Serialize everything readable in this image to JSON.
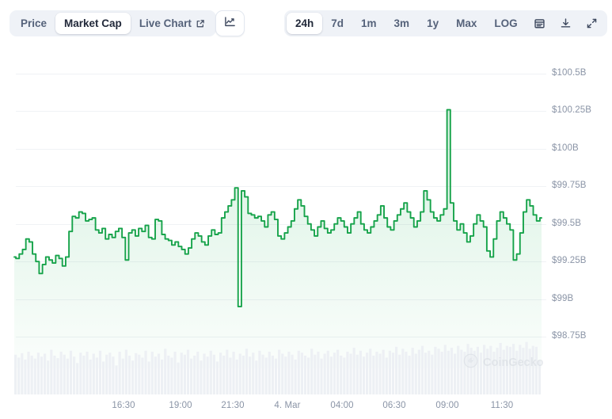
{
  "toolbar": {
    "metric_tabs": [
      {
        "label": "Price",
        "name": "tab-price",
        "active": false,
        "icon": ""
      },
      {
        "label": "Market Cap",
        "name": "tab-market-cap",
        "active": true,
        "icon": ""
      },
      {
        "label": "Live Chart",
        "name": "tab-live-chart",
        "active": false,
        "icon": "external-link-icon"
      }
    ],
    "chart_type_button": {
      "label": "",
      "icon": "line-chart-icon"
    },
    "range_tabs": [
      {
        "label": "24h",
        "name": "range-24h",
        "active": true
      },
      {
        "label": "7d",
        "name": "range-7d",
        "active": false
      },
      {
        "label": "1m",
        "name": "range-1m",
        "active": false
      },
      {
        "label": "3m",
        "name": "range-3m",
        "active": false
      },
      {
        "label": "1y",
        "name": "range-1y",
        "active": false
      },
      {
        "label": "Max",
        "name": "range-max",
        "active": false
      },
      {
        "label": "LOG",
        "name": "scale-log",
        "active": false
      }
    ],
    "action_icons": [
      {
        "name": "calendar-icon",
        "label": "calendar-icon"
      },
      {
        "name": "download-icon",
        "label": "download-icon"
      },
      {
        "name": "expand-icon",
        "label": "expand-icon"
      }
    ]
  },
  "watermark": {
    "text": "CoinGecko",
    "icon": "coingecko-logo-icon"
  },
  "colors": {
    "line": "#16a34a",
    "line_alt": "#1ec05a",
    "area_top": "rgba(34,180,90,0.18)",
    "area_bottom": "rgba(34,180,90,0.02)",
    "grid": "#f0f2f5",
    "axis_text": "#8a94a6",
    "pill_bg": "#eff2f7",
    "pill_active": "#ffffff",
    "nav_bar": "#edf0f4",
    "background": "#ffffff"
  },
  "chart_data": {
    "type": "line",
    "title": "Market Cap",
    "xlabel": "",
    "ylabel": "",
    "currency": "USD",
    "unit": "B",
    "grid": true,
    "legend": false,
    "ylim": [
      98.75,
      100.5
    ],
    "yticks": [
      100.5,
      100.25,
      100,
      99.75,
      99.5,
      99.25,
      99,
      98.75
    ],
    "ytick_labels": [
      "$100.5B",
      "$100.25B",
      "$100B",
      "$99.75B",
      "$99.5B",
      "$99.25B",
      "$99B",
      "$98.75B"
    ],
    "xtick_labels": [
      "16:30",
      "19:00",
      "21:30",
      "4. Mar",
      "04:00",
      "06:30",
      "09:00",
      "11:30"
    ],
    "xtick_positions": [
      156,
      228,
      294,
      363,
      432,
      498,
      565,
      634
    ],
    "series": [
      {
        "name": "Market Cap",
        "color": "#16a34a",
        "values": [
          99.28,
          99.27,
          99.3,
          99.33,
          99.4,
          99.38,
          99.3,
          99.25,
          99.17,
          99.23,
          99.28,
          99.26,
          99.24,
          99.29,
          99.27,
          99.22,
          99.28,
          99.45,
          99.55,
          99.54,
          99.58,
          99.57,
          99.52,
          99.53,
          99.54,
          99.46,
          99.44,
          99.47,
          99.4,
          99.43,
          99.41,
          99.45,
          99.47,
          99.41,
          99.26,
          99.44,
          99.46,
          99.42,
          99.47,
          99.45,
          99.49,
          99.41,
          99.4,
          99.53,
          99.52,
          99.43,
          99.4,
          99.39,
          99.36,
          99.38,
          99.35,
          99.33,
          99.3,
          99.34,
          99.4,
          99.44,
          99.42,
          99.38,
          99.36,
          99.42,
          99.46,
          99.43,
          99.44,
          99.54,
          99.58,
          99.62,
          99.66,
          99.74,
          98.95,
          99.72,
          99.68,
          99.57,
          99.56,
          99.54,
          99.55,
          99.52,
          99.48,
          99.56,
          99.58,
          99.53,
          99.42,
          99.4,
          99.44,
          99.48,
          99.52,
          99.6,
          99.66,
          99.62,
          99.55,
          99.5,
          99.46,
          99.42,
          99.48,
          99.52,
          99.47,
          99.44,
          99.46,
          99.5,
          99.54,
          99.52,
          99.48,
          99.44,
          99.5,
          99.54,
          99.58,
          99.5,
          99.46,
          99.44,
          99.48,
          99.52,
          99.56,
          99.62,
          99.54,
          99.48,
          99.46,
          99.52,
          99.56,
          99.6,
          99.64,
          99.58,
          99.54,
          99.48,
          99.52,
          99.58,
          99.72,
          99.66,
          99.58,
          99.54,
          99.52,
          99.56,
          99.6,
          100.26,
          99.64,
          99.52,
          99.46,
          99.5,
          99.44,
          99.38,
          99.42,
          99.5,
          99.56,
          99.52,
          99.48,
          99.32,
          99.28,
          99.4,
          99.52,
          99.58,
          99.54,
          99.5,
          99.46,
          99.26,
          99.3,
          99.44,
          99.58,
          99.66,
          99.62,
          99.56,
          99.52,
          99.54
        ]
      }
    ],
    "volume_navigator": {
      "type": "bar",
      "color": "#edf0f4",
      "values": [
        52,
        46,
        55,
        42,
        58,
        50,
        44,
        56,
        48,
        54,
        40,
        62,
        50,
        45,
        58,
        52,
        44,
        60,
        48,
        35,
        56,
        50,
        58,
        42,
        54,
        46,
        60,
        38,
        52,
        56,
        48,
        30,
        58,
        44,
        62,
        50,
        40,
        55,
        52,
        46,
        60,
        38,
        58,
        48,
        54,
        42,
        64,
        50,
        46,
        58,
        36,
        56,
        52,
        62,
        44,
        50,
        58,
        40,
        54,
        48,
        60,
        52,
        38,
        56,
        50,
        62,
        46,
        58,
        42,
        54,
        50,
        64,
        48,
        56,
        40,
        60,
        52,
        46,
        58,
        50,
        44,
        62,
        54,
        48,
        58,
        52,
        42,
        60,
        56,
        50,
        46,
        64,
        52,
        58,
        44,
        54,
        60,
        48,
        56,
        62,
        50,
        46,
        58,
        54,
        66,
        52,
        60,
        48,
        56,
        64,
        50,
        58,
        54,
        62,
        46,
        60,
        56,
        68,
        52,
        64,
        58,
        50,
        66,
        54,
        62,
        70,
        56,
        60,
        52,
        68,
        64,
        58,
        72,
        60,
        66,
        54,
        70,
        62,
        58,
        74,
        66,
        60,
        68,
        56,
        72,
        64,
        70,
        58,
        66,
        76,
        62,
        70,
        68,
        74,
        60,
        72,
        66,
        78,
        64,
        70,
        68,
        40
      ]
    }
  }
}
